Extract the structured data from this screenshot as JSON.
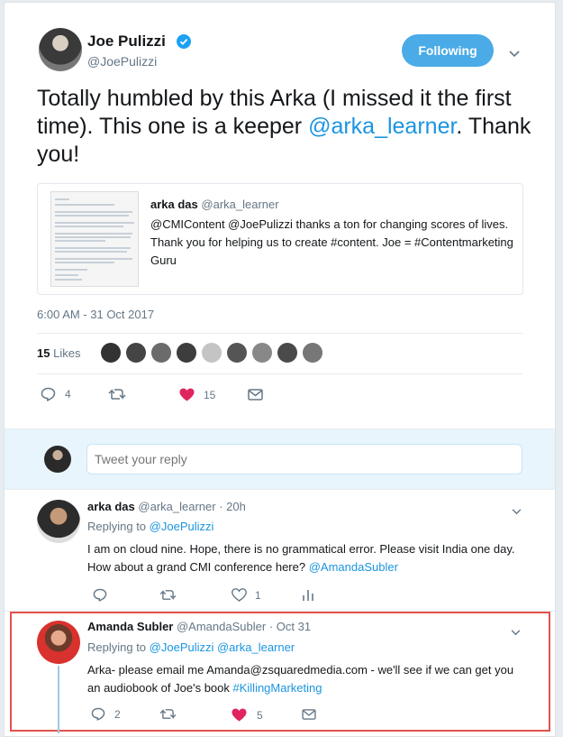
{
  "main_tweet": {
    "author_name": "Joe Pulizzi",
    "author_handle": "@JoePulizzi",
    "follow_label": "Following",
    "text_before": "Totally humbled by this Arka (I missed it the first time). This one is a keeper ",
    "mention": "@arka_learner",
    "text_after": ". Thank you!",
    "quote": {
      "author_name": "arka das",
      "author_handle": "@arka_learner",
      "text": "@CMIContent @JoePulizzi thanks a ton for changing scores of lives. Thank you for helping us to create #content. Joe = #Contentmarketing Guru"
    },
    "timestamp": "6:00 AM - 31 Oct 2017",
    "likes_count": "15",
    "likes_label": "Likes",
    "reply_count": "4",
    "like_count": "15"
  },
  "reply_box": {
    "placeholder": "Tweet your reply"
  },
  "replies": [
    {
      "author_name": "arka das",
      "author_handle": "@arka_learner",
      "time": "· 20h",
      "replying_prefix": "Replying to ",
      "replying_to": "@JoePulizzi",
      "text": "I am on cloud nine. Hope, there is no grammatical error. Please visit India one day. How about a grand CMI conference here? ",
      "text_link": "@AmandaSubler",
      "like_count": "1"
    },
    {
      "author_name": "Amanda Subler",
      "author_handle": "@AmandaSubler",
      "time": "· Oct 31",
      "replying_prefix": "Replying to ",
      "replying_to": "@JoePulizzi @arka_learner",
      "text": "Arka- please email me Amanda@zsquaredmedia.com - we'll see if we can get you  an audiobook of Joe's book ",
      "text_link": "#KillingMarketing",
      "reply_count": "2",
      "like_count": "5"
    }
  ],
  "colors": {
    "accent": "#1da1f2",
    "like_red": "#e0245e",
    "highlight_border": "#e0534a"
  }
}
